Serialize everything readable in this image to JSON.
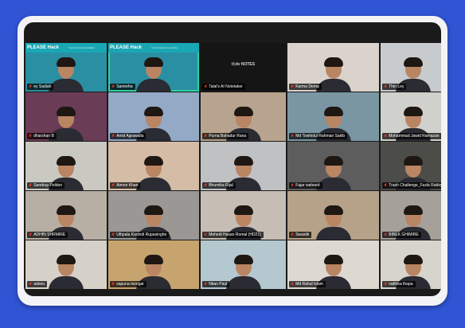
{
  "participants": [
    {
      "name": "ey Sadiah",
      "bg": "#2a8fa3",
      "banner": "PLEASE Hack",
      "banner_sub": "Youth Global Foundation"
    },
    {
      "name": "Samreha",
      "bg": "#2a8fa3",
      "banner": "PLEASE Hack",
      "banner_sub": "Youth Global Foundation",
      "active": true
    },
    {
      "name": "Talal's AI Notetaker",
      "bg": "#151515",
      "logo": "tl;dv NOTES"
    },
    {
      "name": "Karma Dema",
      "bg": "#d9d3cc"
    },
    {
      "name": "Thin Ley",
      "bg": "#c7cbce"
    },
    {
      "name": "dharshan B",
      "bg": "#6b3c55"
    },
    {
      "name": "Ankit Agrawalla",
      "bg": "#93a9c6"
    },
    {
      "name": "Purna Bahadur Rana",
      "bg": "#b8a48e"
    },
    {
      "name": "Md Towhidul Rahman Sakib",
      "bg": "#7a96a3"
    },
    {
      "name": "Mohammad Jawid Ramazan",
      "bg": "#d0d0cc"
    },
    {
      "name": "Sandrup Peldon",
      "bg": "#c9c9c2"
    },
    {
      "name": "Aimon Khan",
      "bg": "#d5bca6"
    },
    {
      "name": "Bhumika Rijal",
      "bg": "#bfc1c3"
    },
    {
      "name": "Fajar waheed",
      "bg": "#5d5d5d"
    },
    {
      "name": "Trash Challenge_Fazla Rabby",
      "bg": "#4c4c48"
    },
    {
      "name": "ADHIN SHRMIRE",
      "bg": "#b7aea4"
    },
    {
      "name": "Uthpala Kavindi Rupasinghe",
      "bg": "#9a9795"
    },
    {
      "name": "Mehedi Hasan Romal (HD21)",
      "bg": "#c6bdb5"
    },
    {
      "name": "Swastik",
      "bg": "#b6a288"
    },
    {
      "name": "BIBEK GHIMIRE",
      "bg": "#a6a09a"
    },
    {
      "name": "adeeu",
      "bg": "#d6d1c8"
    },
    {
      "name": "sapuna mongar",
      "bg": "#c7a46e"
    },
    {
      "name": "Nitan Paul",
      "bg": "#b4c9cf"
    },
    {
      "name": "Md Rahul Islam",
      "bg": "#ddd8d0"
    },
    {
      "name": "radhika thapa",
      "bg": "#d7d4ce"
    }
  ]
}
